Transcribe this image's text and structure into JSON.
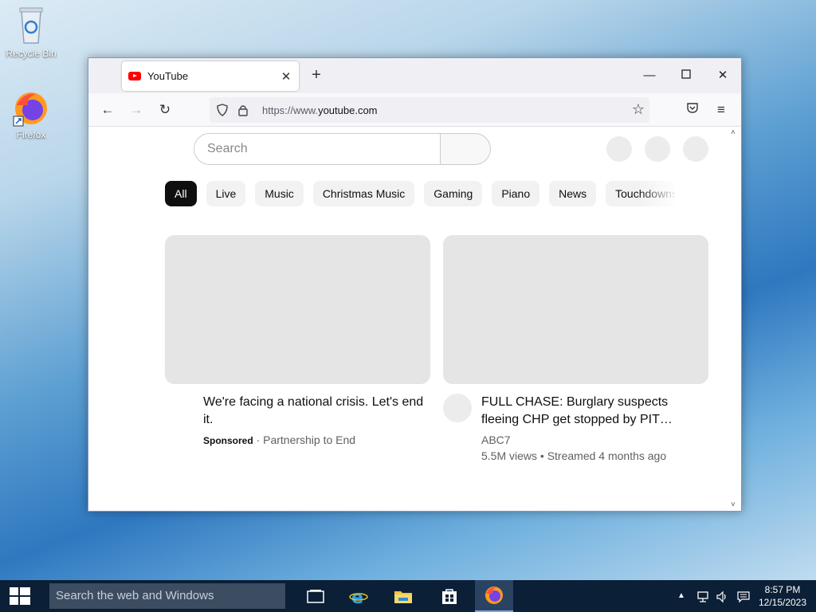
{
  "desktop": {
    "icons": [
      {
        "label": "Recycle Bin",
        "icon": "recycle-bin-icon"
      },
      {
        "label": "Firefox",
        "icon": "firefox-icon"
      }
    ]
  },
  "browser": {
    "tab": {
      "title": "YouTube",
      "icon": "youtube-icon"
    },
    "address": {
      "prefix": "https://www.",
      "domain": "youtube.com"
    }
  },
  "youtube": {
    "search_placeholder": "Search",
    "chips": [
      "All",
      "Live",
      "Music",
      "Christmas Music",
      "Gaming",
      "Piano",
      "News",
      "Touchdowns"
    ],
    "videos": [
      {
        "title": "We're facing a national crisis. Let's end it.",
        "sponsored": "Sponsored",
        "sub": "· Partnership to End"
      },
      {
        "title": "FULL CHASE: Burglary suspects fleeing CHP get stopped by PIT…",
        "channel": "ABC7",
        "stats": "5.5M views • Streamed 4 months ago"
      }
    ]
  },
  "taskbar": {
    "search_placeholder": "Search the web and Windows",
    "time": "8:57 PM",
    "date": "12/15/2023"
  },
  "colors": {
    "accent_red": "#ff0000",
    "taskbar": "#0b1f36",
    "chip_active": "#0f0f0f"
  }
}
